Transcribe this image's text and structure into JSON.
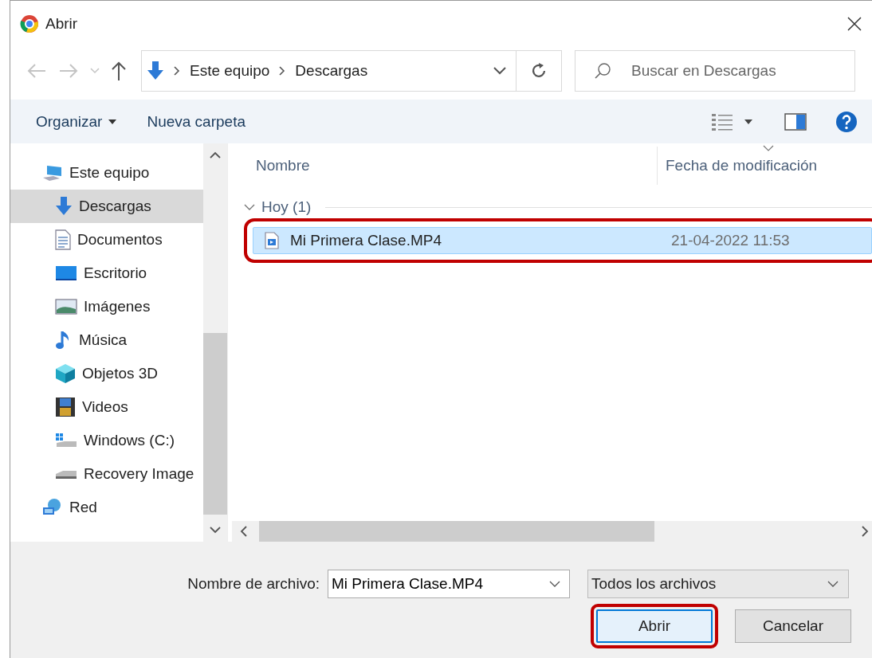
{
  "window": {
    "title": "Abrir"
  },
  "address": {
    "path": [
      "Este equipo",
      "Descargas"
    ]
  },
  "search": {
    "placeholder": "Buscar en Descargas"
  },
  "toolbar": {
    "organize": "Organizar",
    "new_folder": "Nueva carpeta"
  },
  "sidebar": {
    "items": [
      {
        "label": "Este equipo",
        "kind": "pc",
        "selected": false,
        "children": [
          {
            "label": "Descargas",
            "kind": "download",
            "selected": true
          },
          {
            "label": "Documentos",
            "kind": "document",
            "selected": false
          },
          {
            "label": "Escritorio",
            "kind": "desktop",
            "selected": false
          },
          {
            "label": "Imágenes",
            "kind": "pictures",
            "selected": false
          },
          {
            "label": "Música",
            "kind": "music",
            "selected": false
          },
          {
            "label": "Objetos 3D",
            "kind": "cube",
            "selected": false
          },
          {
            "label": "Videos",
            "kind": "film",
            "selected": false
          },
          {
            "label": "Windows (C:)",
            "kind": "windrive",
            "selected": false
          },
          {
            "label": "Recovery Image",
            "kind": "drive",
            "selected": false
          }
        ]
      },
      {
        "label": "Red",
        "kind": "network",
        "selected": false
      }
    ]
  },
  "columns": [
    "Nombre",
    "Fecha de modificación"
  ],
  "groups": [
    {
      "label": "Hoy (1)",
      "expanded": true,
      "files": [
        {
          "name": "Mi Primera Clase.MP4",
          "date": "21-04-2022 11:53",
          "selected": true,
          "highlighted": true
        }
      ]
    }
  ],
  "footer": {
    "filename_label": "Nombre de archivo:",
    "filename": "Mi Primera Clase.MP4",
    "filter": "Todos los archivos",
    "buttons": [
      {
        "label": "Abrir",
        "highlighted": true
      },
      {
        "label": "Cancelar",
        "highlighted": false
      }
    ]
  }
}
